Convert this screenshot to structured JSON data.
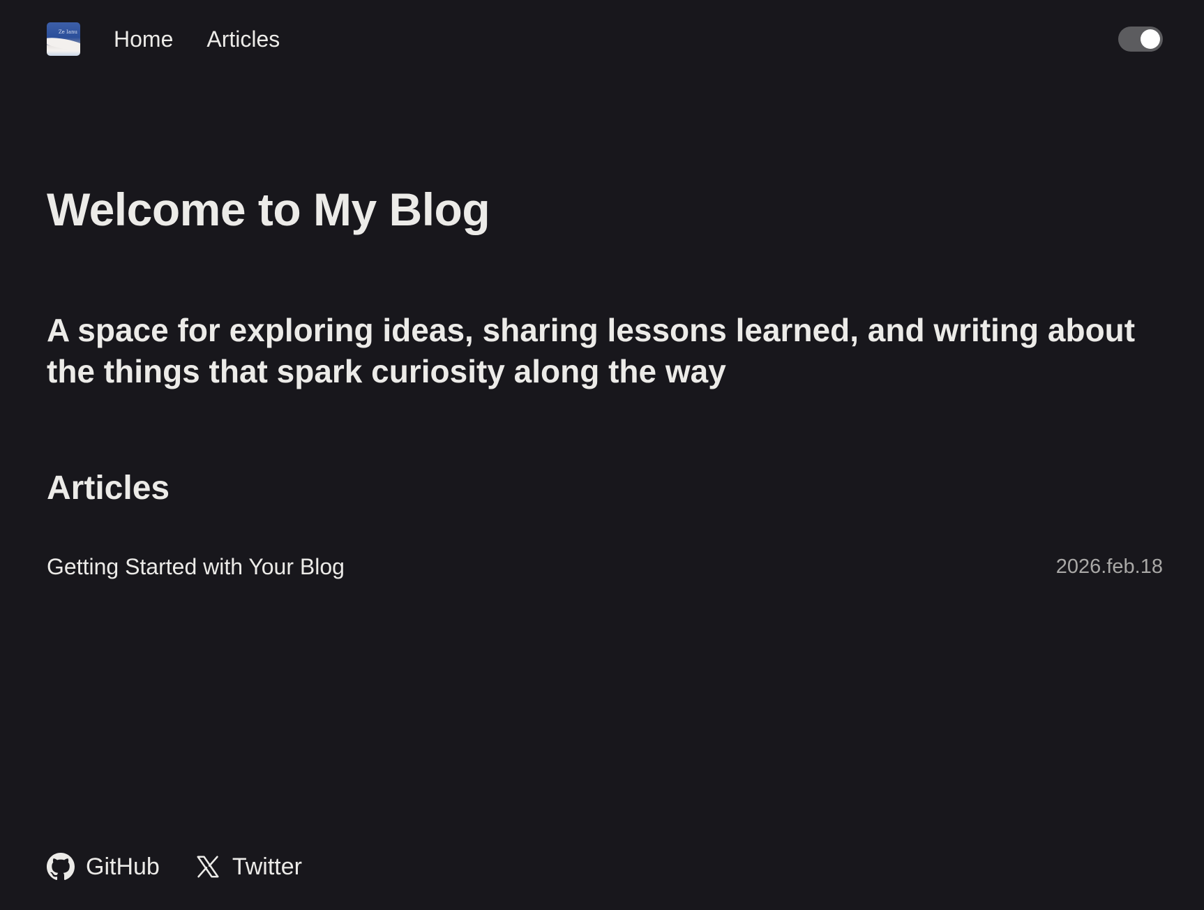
{
  "header": {
    "logo_text": "Ze Ianu",
    "nav": [
      {
        "label": "Home"
      },
      {
        "label": "Articles"
      }
    ],
    "theme_toggle": {
      "state": "on",
      "icon": "theme-toggle-icon"
    }
  },
  "hero": {
    "title": "Welcome to My Blog",
    "subtitle": "A space for exploring ideas, sharing lessons learned, and writing about the things that spark curiosity along the way"
  },
  "articles": {
    "heading": "Articles",
    "items": [
      {
        "title": "Getting Started with Your Blog",
        "date": "2026.feb.18"
      }
    ]
  },
  "footer": {
    "links": [
      {
        "label": "GitHub",
        "icon": "github-icon"
      },
      {
        "label": "Twitter",
        "icon": "x-icon"
      }
    ]
  },
  "colors": {
    "background": "#18171c",
    "text": "#ecebe8",
    "muted": "#a9a8a6",
    "toggle_track": "#5c5c5f"
  }
}
